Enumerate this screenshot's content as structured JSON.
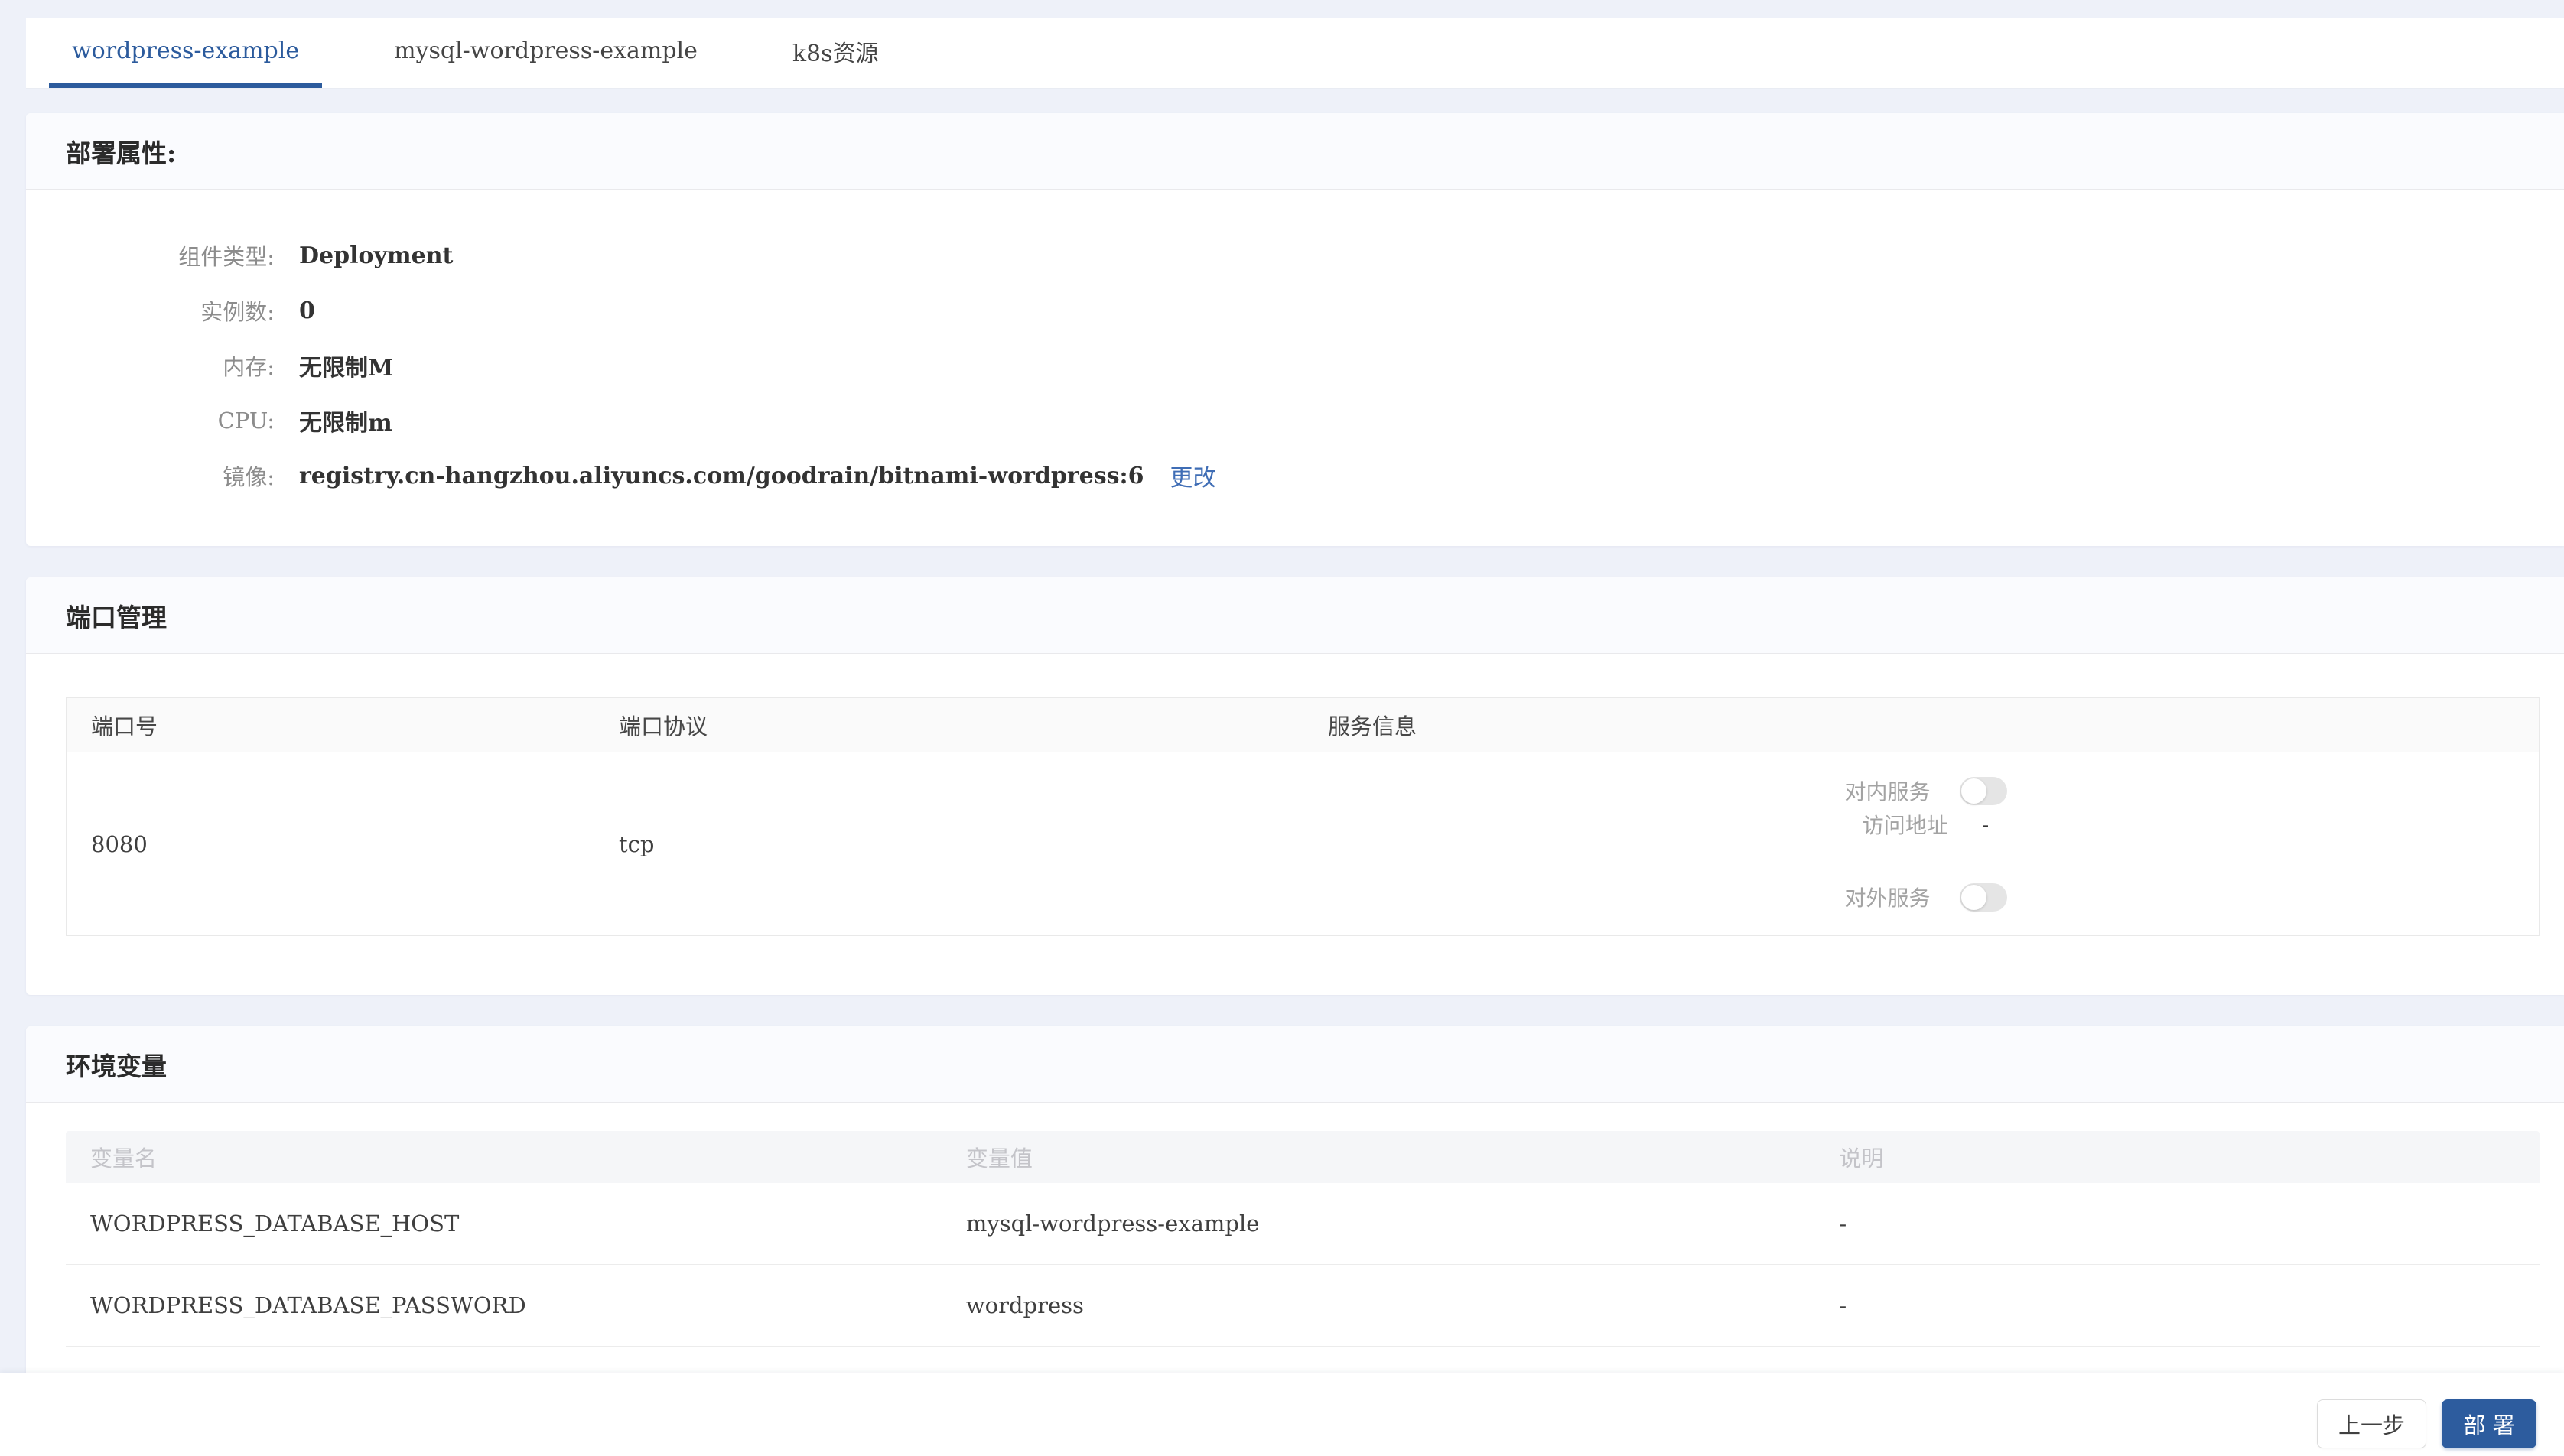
{
  "tabs": [
    {
      "label": "wordpress-example",
      "active": true
    },
    {
      "label": "mysql-wordpress-example",
      "active": false
    },
    {
      "label": "k8s资源",
      "active": false
    }
  ],
  "deploy_card": {
    "title": "部署属性:",
    "fields": [
      {
        "label": "组件类型:",
        "value": "Deployment"
      },
      {
        "label": "实例数:",
        "value": "0"
      },
      {
        "label": "内存:",
        "value": "无限制M"
      },
      {
        "label": "CPU:",
        "value": "无限制m"
      },
      {
        "label": "镜像:",
        "value": "registry.cn-hangzhou.aliyuncs.com/goodrain/bitnami-wordpress:6",
        "action": "更改"
      }
    ]
  },
  "ports_card": {
    "title": "端口管理",
    "columns": [
      "端口号",
      "端口协议",
      "服务信息"
    ],
    "rows": [
      {
        "port": "8080",
        "protocol": "tcp",
        "service": {
          "inner_label": "对内服务",
          "inner_toggle_state": "off",
          "access_label": "访问地址",
          "access_value": "-",
          "outer_label": "对外服务",
          "outer_toggle_state": "off"
        }
      }
    ]
  },
  "env_card": {
    "title": "环境变量",
    "columns": [
      "变量名",
      "变量值",
      "说明"
    ],
    "rows": [
      [
        "WORDPRESS_DATABASE_HOST",
        "mysql-wordpress-example",
        "-"
      ],
      [
        "WORDPRESS_DATABASE_PASSWORD",
        "wordpress",
        "-"
      ]
    ]
  },
  "footer": {
    "prev_label": "上一步",
    "deploy_label": "部 署"
  },
  "colors": {
    "accent_blue": "#2c5b9d",
    "link_blue": "#3f6db5",
    "page_background": "#eef1f9",
    "toggle_off": "#e5e5e5"
  }
}
